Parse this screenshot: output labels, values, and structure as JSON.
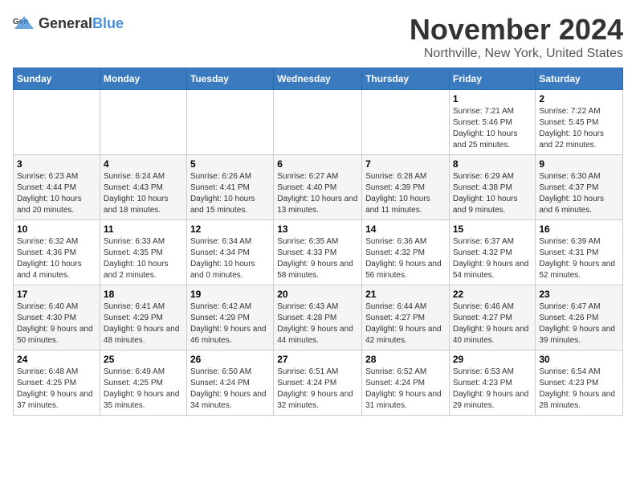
{
  "logo": {
    "general": "General",
    "blue": "Blue"
  },
  "title": "November 2024",
  "subtitle": "Northville, New York, United States",
  "days_of_week": [
    "Sunday",
    "Monday",
    "Tuesday",
    "Wednesday",
    "Thursday",
    "Friday",
    "Saturday"
  ],
  "weeks": [
    [
      {
        "day": "",
        "info": ""
      },
      {
        "day": "",
        "info": ""
      },
      {
        "day": "",
        "info": ""
      },
      {
        "day": "",
        "info": ""
      },
      {
        "day": "",
        "info": ""
      },
      {
        "day": "1",
        "info": "Sunrise: 7:21 AM\nSunset: 5:46 PM\nDaylight: 10 hours and 25 minutes."
      },
      {
        "day": "2",
        "info": "Sunrise: 7:22 AM\nSunset: 5:45 PM\nDaylight: 10 hours and 22 minutes."
      }
    ],
    [
      {
        "day": "3",
        "info": "Sunrise: 6:23 AM\nSunset: 4:44 PM\nDaylight: 10 hours and 20 minutes."
      },
      {
        "day": "4",
        "info": "Sunrise: 6:24 AM\nSunset: 4:43 PM\nDaylight: 10 hours and 18 minutes."
      },
      {
        "day": "5",
        "info": "Sunrise: 6:26 AM\nSunset: 4:41 PM\nDaylight: 10 hours and 15 minutes."
      },
      {
        "day": "6",
        "info": "Sunrise: 6:27 AM\nSunset: 4:40 PM\nDaylight: 10 hours and 13 minutes."
      },
      {
        "day": "7",
        "info": "Sunrise: 6:28 AM\nSunset: 4:39 PM\nDaylight: 10 hours and 11 minutes."
      },
      {
        "day": "8",
        "info": "Sunrise: 6:29 AM\nSunset: 4:38 PM\nDaylight: 10 hours and 9 minutes."
      },
      {
        "day": "9",
        "info": "Sunrise: 6:30 AM\nSunset: 4:37 PM\nDaylight: 10 hours and 6 minutes."
      }
    ],
    [
      {
        "day": "10",
        "info": "Sunrise: 6:32 AM\nSunset: 4:36 PM\nDaylight: 10 hours and 4 minutes."
      },
      {
        "day": "11",
        "info": "Sunrise: 6:33 AM\nSunset: 4:35 PM\nDaylight: 10 hours and 2 minutes."
      },
      {
        "day": "12",
        "info": "Sunrise: 6:34 AM\nSunset: 4:34 PM\nDaylight: 10 hours and 0 minutes."
      },
      {
        "day": "13",
        "info": "Sunrise: 6:35 AM\nSunset: 4:33 PM\nDaylight: 9 hours and 58 minutes."
      },
      {
        "day": "14",
        "info": "Sunrise: 6:36 AM\nSunset: 4:32 PM\nDaylight: 9 hours and 56 minutes."
      },
      {
        "day": "15",
        "info": "Sunrise: 6:37 AM\nSunset: 4:32 PM\nDaylight: 9 hours and 54 minutes."
      },
      {
        "day": "16",
        "info": "Sunrise: 6:39 AM\nSunset: 4:31 PM\nDaylight: 9 hours and 52 minutes."
      }
    ],
    [
      {
        "day": "17",
        "info": "Sunrise: 6:40 AM\nSunset: 4:30 PM\nDaylight: 9 hours and 50 minutes."
      },
      {
        "day": "18",
        "info": "Sunrise: 6:41 AM\nSunset: 4:29 PM\nDaylight: 9 hours and 48 minutes."
      },
      {
        "day": "19",
        "info": "Sunrise: 6:42 AM\nSunset: 4:29 PM\nDaylight: 9 hours and 46 minutes."
      },
      {
        "day": "20",
        "info": "Sunrise: 6:43 AM\nSunset: 4:28 PM\nDaylight: 9 hours and 44 minutes."
      },
      {
        "day": "21",
        "info": "Sunrise: 6:44 AM\nSunset: 4:27 PM\nDaylight: 9 hours and 42 minutes."
      },
      {
        "day": "22",
        "info": "Sunrise: 6:46 AM\nSunset: 4:27 PM\nDaylight: 9 hours and 40 minutes."
      },
      {
        "day": "23",
        "info": "Sunrise: 6:47 AM\nSunset: 4:26 PM\nDaylight: 9 hours and 39 minutes."
      }
    ],
    [
      {
        "day": "24",
        "info": "Sunrise: 6:48 AM\nSunset: 4:25 PM\nDaylight: 9 hours and 37 minutes."
      },
      {
        "day": "25",
        "info": "Sunrise: 6:49 AM\nSunset: 4:25 PM\nDaylight: 9 hours and 35 minutes."
      },
      {
        "day": "26",
        "info": "Sunrise: 6:50 AM\nSunset: 4:24 PM\nDaylight: 9 hours and 34 minutes."
      },
      {
        "day": "27",
        "info": "Sunrise: 6:51 AM\nSunset: 4:24 PM\nDaylight: 9 hours and 32 minutes."
      },
      {
        "day": "28",
        "info": "Sunrise: 6:52 AM\nSunset: 4:24 PM\nDaylight: 9 hours and 31 minutes."
      },
      {
        "day": "29",
        "info": "Sunrise: 6:53 AM\nSunset: 4:23 PM\nDaylight: 9 hours and 29 minutes."
      },
      {
        "day": "30",
        "info": "Sunrise: 6:54 AM\nSunset: 4:23 PM\nDaylight: 9 hours and 28 minutes."
      }
    ]
  ]
}
